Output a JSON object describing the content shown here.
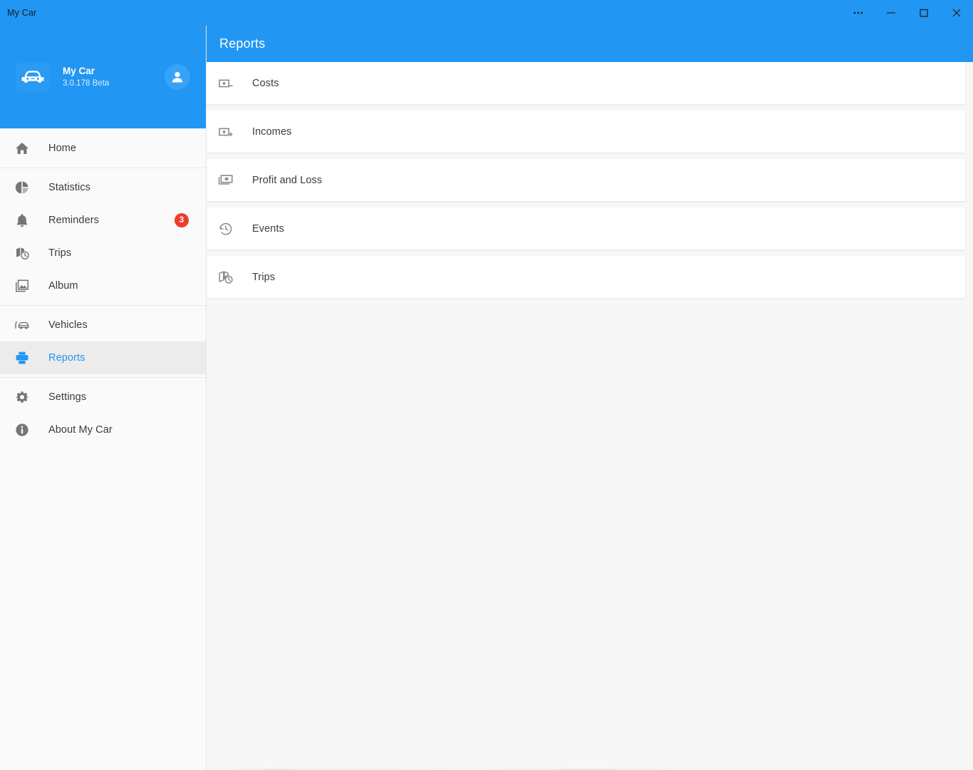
{
  "window": {
    "title": "My Car",
    "caption_buttons": [
      {
        "name": "more-options",
        "glyph": "⋯"
      },
      {
        "name": "minimize",
        "glyph": "—"
      },
      {
        "name": "maximize",
        "glyph": "□"
      },
      {
        "name": "close",
        "glyph": "✕"
      }
    ]
  },
  "brand": {
    "name": "My Car",
    "version": "3.0.178 Beta",
    "logo_icon": "car-icon",
    "avatar_icon": "person-icon"
  },
  "sidebar": {
    "sections": [
      {
        "items": [
          {
            "label": "Home",
            "icon": "home-icon",
            "selected": false,
            "badge": ""
          }
        ]
      },
      {
        "items": [
          {
            "label": "Statistics",
            "icon": "pie-chart-icon",
            "selected": false,
            "badge": ""
          },
          {
            "label": "Reminders",
            "icon": "bell-icon",
            "selected": false,
            "badge": "3"
          },
          {
            "label": "Trips",
            "icon": "map-clock-icon",
            "selected": false,
            "badge": ""
          },
          {
            "label": "Album",
            "icon": "photo-icon",
            "selected": false,
            "badge": ""
          }
        ]
      },
      {
        "items": [
          {
            "label": "Vehicles",
            "icon": "car-side-icon",
            "selected": false,
            "badge": ""
          },
          {
            "label": "Reports",
            "icon": "printer-icon",
            "selected": true,
            "badge": ""
          }
        ]
      },
      {
        "items": [
          {
            "label": "Settings",
            "icon": "gear-icon",
            "selected": false,
            "badge": ""
          },
          {
            "label": "About My Car",
            "icon": "info-icon",
            "selected": false,
            "badge": ""
          }
        ]
      }
    ]
  },
  "main": {
    "title": "Reports",
    "items": [
      {
        "label": "Costs",
        "icon": "banknote-minus-icon"
      },
      {
        "label": "Incomes",
        "icon": "banknote-plus-icon"
      },
      {
        "label": "Profit and Loss",
        "icon": "banknotes-icon"
      },
      {
        "label": "Events",
        "icon": "history-clock-icon"
      },
      {
        "label": "Trips",
        "icon": "map-clock-icon"
      }
    ]
  },
  "colors": {
    "accent": "#2196f3",
    "badge": "#ef3b2d",
    "sidebar_bg": "#fafafa",
    "selected_bg": "#ececec",
    "content_bg": "#f7f7f7",
    "card_bg": "#ffffff"
  }
}
